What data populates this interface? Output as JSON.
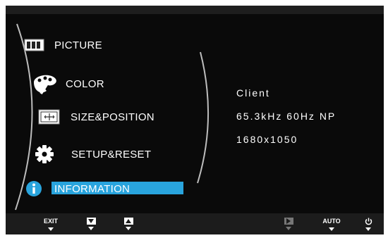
{
  "menu": {
    "items": [
      {
        "label": "PICTURE",
        "icon": "picture-icon"
      },
      {
        "label": "COLOR",
        "icon": "palette-icon"
      },
      {
        "label": "SIZE&POSITION",
        "icon": "size-position-icon"
      },
      {
        "label": "SETUP&RESET",
        "icon": "gear-icon"
      },
      {
        "label": "INFORMATION",
        "icon": "info-icon",
        "selected": true
      }
    ]
  },
  "info": {
    "lines": [
      "Client",
      "65.3kHz 60Hz NP",
      "1680x1050"
    ]
  },
  "footer": {
    "exit_label": "EXIT",
    "auto_label": "AUTO"
  },
  "colors": {
    "accent": "#29a4dd",
    "background": "#0a0a0a",
    "text": "#ffffff"
  }
}
